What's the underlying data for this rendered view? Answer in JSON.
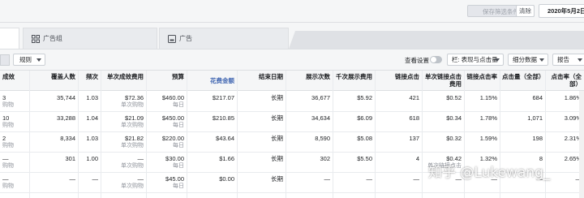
{
  "topbar": {
    "save_filter_label": "保存筛选条件",
    "clear_label": "清除",
    "date_label": "2020年5月2日"
  },
  "tabs": [
    {
      "label": ""
    },
    {
      "label": "广告组"
    },
    {
      "label": "广告"
    }
  ],
  "toolbar": {
    "rules_label": "规则",
    "view_settings_label": "查看设置",
    "columns_label": "栏: 表现与点击量",
    "breakdown_label": "细分数据",
    "report_label": "报告"
  },
  "table": {
    "headers": [
      "成效",
      "覆盖人数",
      "频次",
      "单次成效费用",
      "预算",
      "花费金额",
      "结束日期",
      "展示次数",
      "千次展示费用",
      "链接点击",
      "单次链接点击费用",
      "链接点击率",
      "点击量（全部）",
      "点击率（全部）"
    ],
    "sorted_column": "花费金额",
    "rows": [
      {
        "results": "3",
        "results_sub": "购物",
        "reach": "35,744",
        "frequency": "1.03",
        "cost_per_result": "$72.36",
        "cost_per_result_sub": "单次购物",
        "budget": "$460.00",
        "budget_sub": "每日",
        "spend": "$217.07",
        "end": "长期",
        "impressions": "36,677",
        "cpm": "$5.92",
        "link_clicks": "421",
        "cpc": "$0.52",
        "ctr": "1.15%",
        "clicks_all": "684",
        "ctr_all": "1.86%"
      },
      {
        "results": "10",
        "results_sub": "购物",
        "reach": "33,288",
        "frequency": "1.04",
        "cost_per_result": "$21.09",
        "cost_per_result_sub": "单次购物",
        "budget": "$450.00",
        "budget_sub": "每日",
        "spend": "$210.85",
        "end": "长期",
        "impressions": "34,634",
        "cpm": "$6.09",
        "link_clicks": "618",
        "cpc": "$0.34",
        "ctr": "1.78%",
        "clicks_all": "1,071",
        "ctr_all": "3.09%"
      },
      {
        "results": "2",
        "results_sub": "购物",
        "reach": "8,334",
        "frequency": "1.03",
        "cost_per_result": "$21.82",
        "cost_per_result_sub": "单次购物",
        "budget": "$220.00",
        "budget_sub": "每日",
        "spend": "$43.64",
        "end": "长期",
        "impressions": "8,590",
        "cpm": "$5.08",
        "link_clicks": "137",
        "cpc": "$0.32",
        "ctr": "1.59%",
        "clicks_all": "198",
        "ctr_all": "2.31%"
      },
      {
        "results": "—",
        "results_sub": "购物",
        "reach": "301",
        "frequency": "1.00",
        "cost_per_result": "—",
        "cost_per_result_sub": "单次购物",
        "budget": "$30.00",
        "budget_sub": "每日",
        "spend": "$1.66",
        "end": "长期",
        "impressions": "302",
        "cpm": "$5.50",
        "link_clicks": "4",
        "cpc": "$0.42",
        "cpc_sub": "单次链接点击",
        "ctr": "1.32%",
        "clicks_all": "8",
        "ctr_all": "2.65%"
      },
      {
        "results": "—",
        "results_sub": "购物",
        "reach": "—",
        "frequency": "—",
        "cost_per_result": "—",
        "cost_per_result_sub": "单次购物",
        "budget": "$45.00",
        "budget_sub": "每日",
        "spend": "$0.00",
        "end": "长期",
        "impressions": "—",
        "cpm": "—",
        "link_clicks": "—",
        "cpc": "—",
        "ctr": "—",
        "clicks_all": "—",
        "ctr_all": "—"
      }
    ]
  },
  "watermark": "知乎 @Lukewang_",
  "colors": {
    "accent": "#4267b2",
    "header_bg": "#f5f6f7",
    "border": "#dddfe2"
  }
}
